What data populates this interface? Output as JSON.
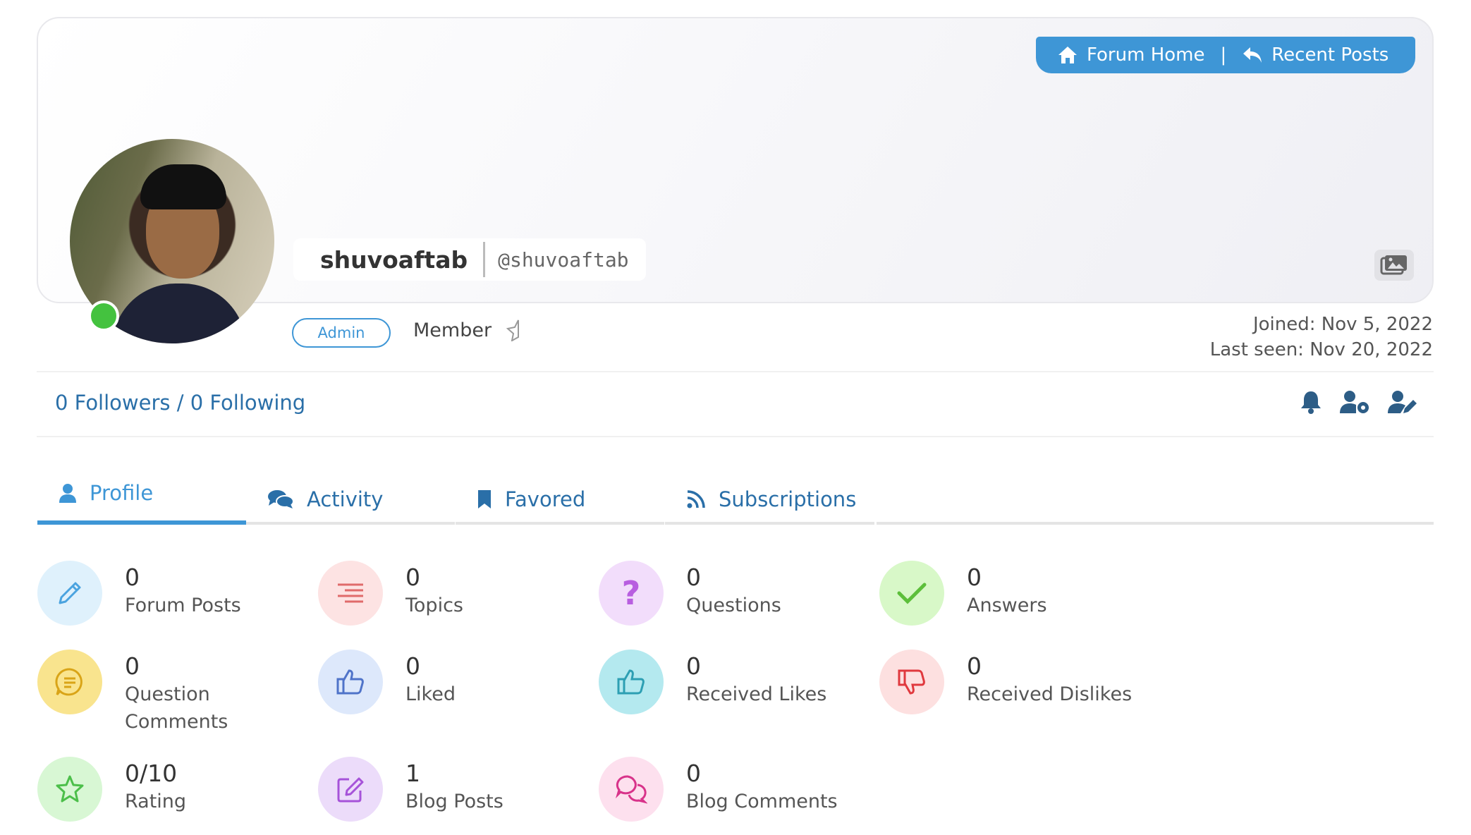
{
  "nav": {
    "forum_home": "Forum Home",
    "separator": "|",
    "recent_posts": "Recent Posts"
  },
  "profile": {
    "display_name": "shuvoaftab",
    "username": "@shuvoaftab",
    "role": "Admin",
    "rank": "Member",
    "joined": "Joined: Nov 5, 2022",
    "last_seen": "Last seen: Nov 20, 2022",
    "follow_text": "0 Followers / 0 Following"
  },
  "tabs": [
    {
      "label": "Profile",
      "icon": "user-icon"
    },
    {
      "label": "Activity",
      "icon": "comments-icon"
    },
    {
      "label": "Favored",
      "icon": "bookmark-icon"
    },
    {
      "label": "Subscriptions",
      "icon": "rss-icon"
    }
  ],
  "stats": [
    {
      "value": "0",
      "label": "Forum Posts",
      "icon": "pencil-icon",
      "bg": "#dff1fc",
      "fg": "#4aa3df"
    },
    {
      "value": "0",
      "label": "Topics",
      "icon": "list-icon",
      "bg": "#fde3e3",
      "fg": "#e06b6b"
    },
    {
      "value": "0",
      "label": "Questions",
      "icon": "question-icon",
      "bg": "#f2ddfb",
      "fg": "#b85ee0"
    },
    {
      "value": "0",
      "label": "Answers",
      "icon": "check-icon",
      "bg": "#d8f8c8",
      "fg": "#5cbf3a"
    },
    {
      "value": "0",
      "label": "Question",
      "label2": "Comments",
      "icon": "comment-icon",
      "bg": "#f9e48e",
      "fg": "#d9a417"
    },
    {
      "value": "0",
      "label": "Liked",
      "icon": "thumbs-up-icon",
      "bg": "#dde8fb",
      "fg": "#4f73c9"
    },
    {
      "value": "0",
      "label": "Received Likes",
      "icon": "thumbs-up-icon",
      "bg": "#b4e9ef",
      "fg": "#2d9fb3"
    },
    {
      "value": "0",
      "label": "Received Dislikes",
      "icon": "thumbs-down-icon",
      "bg": "#fde0e0",
      "fg": "#e0393e"
    },
    {
      "value": "0/10",
      "label": "Rating",
      "icon": "star-icon",
      "bg": "#d8f7d4",
      "fg": "#4cbf4a"
    },
    {
      "value": "1",
      "label": "Blog Posts",
      "icon": "edit-icon",
      "bg": "#ecdcfa",
      "fg": "#a653d9"
    },
    {
      "value": "0",
      "label": "Blog Comments",
      "icon": "comments-icon",
      "bg": "#fde0ee",
      "fg": "#d8338a"
    }
  ]
}
